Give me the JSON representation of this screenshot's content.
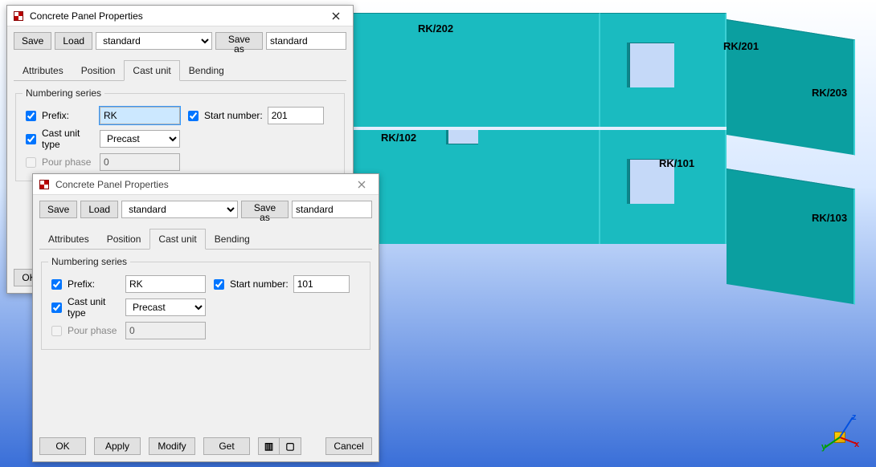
{
  "viewport_labels": {
    "p202": "RK/202",
    "p201": "RK/201",
    "p203": "RK/203",
    "p102": "RK/102",
    "p101": "RK/101",
    "p103": "RK/103"
  },
  "axis": {
    "x": "x",
    "y": "y",
    "z": "z"
  },
  "dialog1": {
    "title": "Concrete Panel Properties",
    "toolbar": {
      "save": "Save",
      "load": "Load",
      "preset_select": "standard",
      "save_as": "Save as",
      "save_as_name": "standard"
    },
    "tabs": {
      "attributes": "Attributes",
      "position": "Position",
      "cast_unit": "Cast unit",
      "bending": "Bending"
    },
    "group_title": "Numbering series",
    "fields": {
      "prefix_label": "Prefix:",
      "prefix_value": "RK",
      "start_label": "Start number:",
      "start_value": "201",
      "cast_type_label": "Cast unit type",
      "cast_type_value": "Precast",
      "pour_label": "Pour phase",
      "pour_value": "0"
    },
    "buttons": {
      "ok": "OK"
    }
  },
  "dialog2": {
    "title": "Concrete Panel Properties",
    "toolbar": {
      "save": "Save",
      "load": "Load",
      "preset_select": "standard",
      "save_as": "Save as",
      "save_as_name": "standard"
    },
    "tabs": {
      "attributes": "Attributes",
      "position": "Position",
      "cast_unit": "Cast unit",
      "bending": "Bending"
    },
    "group_title": "Numbering series",
    "fields": {
      "prefix_label": "Prefix:",
      "prefix_value": "RK",
      "start_label": "Start number:",
      "start_value": "101",
      "cast_type_label": "Cast unit type",
      "cast_type_value": "Precast",
      "pour_label": "Pour phase",
      "pour_value": "0"
    },
    "buttons": {
      "ok": "OK",
      "apply": "Apply",
      "modify": "Modify",
      "get": "Get",
      "cancel": "Cancel"
    },
    "toggle": {
      "on": "✔",
      "off": "☐"
    }
  }
}
